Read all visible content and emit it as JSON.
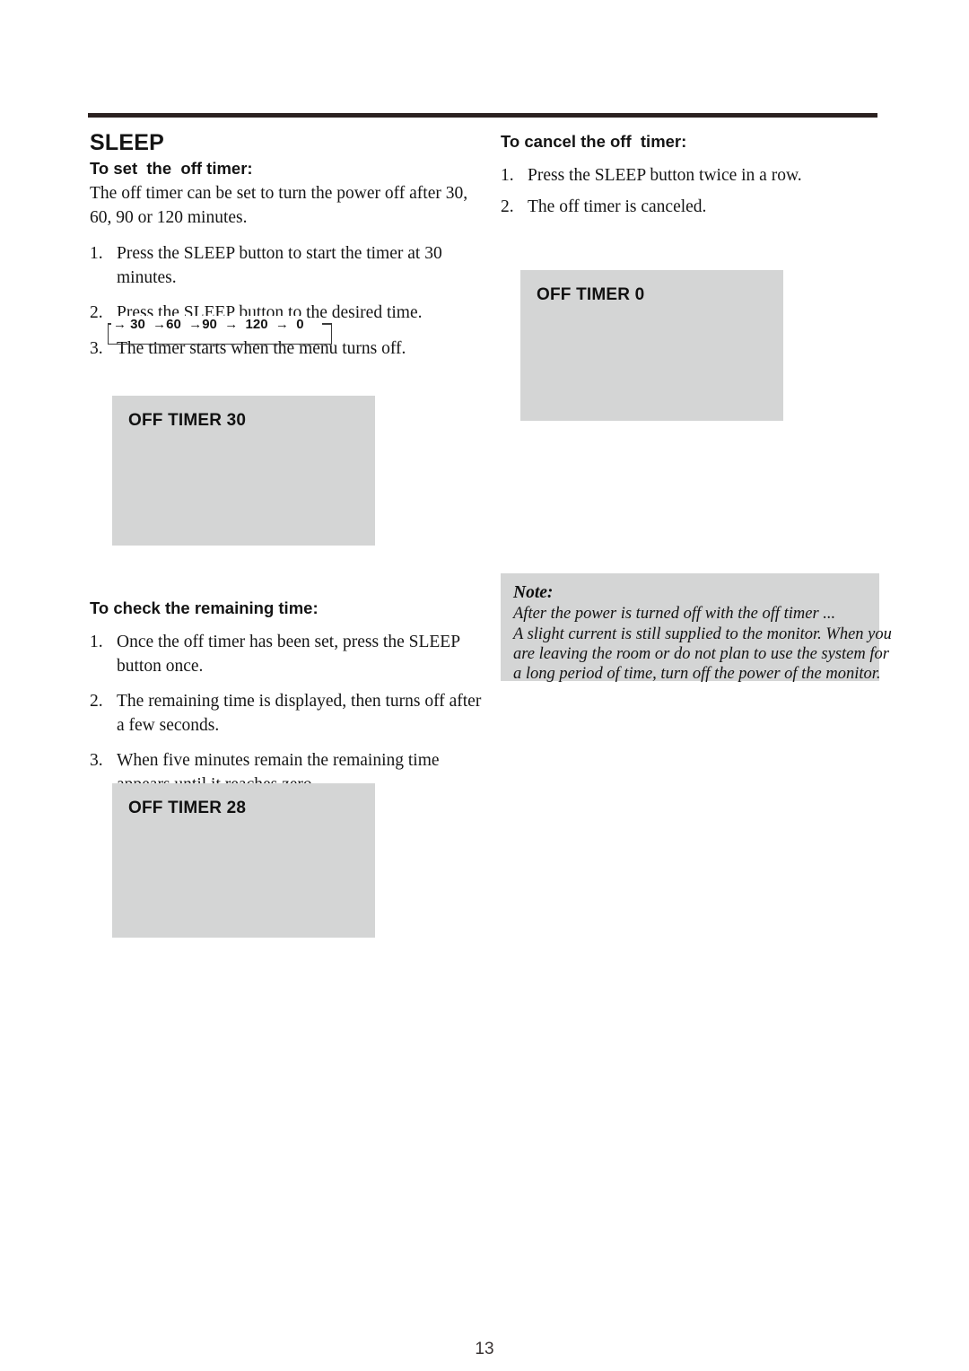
{
  "page": {
    "number": "13",
    "rule_color": "#2b2120",
    "osd_bg_color": "#d4d5d5"
  },
  "left": {
    "title": "SLEEP",
    "set_heading": "To set  the  off timer:",
    "intro": "The off timer can be set to turn the power off after 30, 60, 90 or 120 minutes.",
    "set_steps": [
      {
        "num": "1.",
        "text": "Press the SLEEP button to start the timer at 30 minutes."
      },
      {
        "num": "2.",
        "text": "Press the SLEEP button to the desired time."
      },
      {
        "num": "3.",
        "text": "The timer starts when the menu turns off."
      }
    ],
    "check_heading": "To check the remaining time:",
    "check_steps": [
      {
        "num": "1.",
        "text": "Once the off timer has been set, press the SLEEP button once."
      },
      {
        "num": "2.",
        "text": "The remaining time is displayed, then turns off after a few seconds."
      },
      {
        "num": "3.",
        "text": "When five minutes remain the remaining time appears until it reaches zero."
      }
    ]
  },
  "right": {
    "cancel_heading": "To cancel the off  timer:",
    "cancel_steps": [
      {
        "num": "1.",
        "text": "Press the SLEEP button twice in a row."
      },
      {
        "num": "2.",
        "text": "The off timer is canceled."
      }
    ],
    "note": {
      "title": "Note:",
      "lines": [
        "After the power is turned off with the off timer ...",
        "A slight current is still supplied to the monitor. When you",
        "are leaving the room or do not plan to use the system for",
        "a long period of time, turn off the power of the monitor."
      ]
    }
  },
  "timer_cycle": {
    "sequence": "→ 30  →60  →90  →  120  →  0",
    "values": [
      "30",
      "60",
      "90",
      "120",
      "0"
    ],
    "arrow_glyph": "→",
    "loops_back": true
  },
  "osd_screens": [
    {
      "id": "osd-30",
      "label": "OFF TIMER 30",
      "timer_value": "30"
    },
    {
      "id": "osd-0",
      "label": "OFF TIMER 0",
      "timer_value": "0"
    },
    {
      "id": "osd-28",
      "label": "OFF TIMER 28",
      "timer_value": "28"
    }
  ]
}
